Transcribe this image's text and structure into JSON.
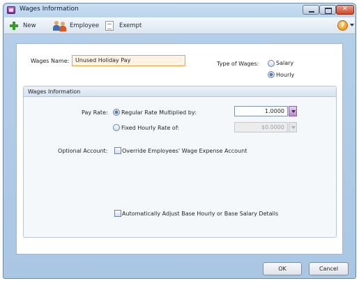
{
  "window": {
    "title": "Wages Information",
    "accent": "#b4cfe8"
  },
  "toolbar": {
    "new_label": "New",
    "employee_label": "Employee",
    "exempt_label": "Exempt",
    "help_icon": "?"
  },
  "form": {
    "wages_name_label": "Wages Name:",
    "wages_name_value": "Unused Holiday Pay",
    "type_label": "Type of Wages:",
    "type_options": [
      "Salary",
      "Hourly"
    ],
    "type_selected": "Hourly"
  },
  "group": {
    "title": "Wages Information",
    "pay_rate_label": "Pay Rate:",
    "regular_label": "Regular Rate Multiplied by:",
    "regular_value": "1.0000",
    "fixed_label": "Fixed Hourly Rate of:",
    "fixed_value": "$0.0000",
    "pay_rate_selected": "Regular Rate Multiplied by:",
    "optional_label": "Optional Account:",
    "override_label": "Override Employees' Wage Expense Account",
    "override_checked": false,
    "auto_adjust_label": "Automatically Adjust Base Hourly or Base Salary Details",
    "auto_adjust_checked": false
  },
  "footer": {
    "ok_label": "OK",
    "cancel_label": "Cancel"
  }
}
